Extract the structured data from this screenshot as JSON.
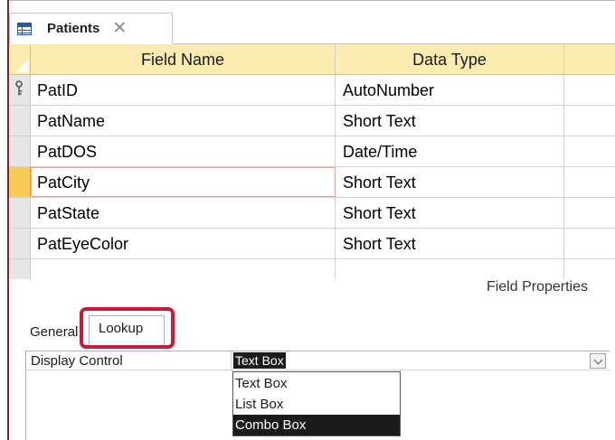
{
  "document_tab": {
    "title": "Patients",
    "close_glyph": "✕",
    "icon": "table-icon"
  },
  "grid": {
    "columns": [
      "Field Name",
      "Data Type"
    ],
    "rows": [
      {
        "field_name": "PatID",
        "data_type": "AutoNumber",
        "primary_key": true
      },
      {
        "field_name": "PatName",
        "data_type": "Short Text"
      },
      {
        "field_name": "PatDOS",
        "data_type": "Date/Time"
      },
      {
        "field_name": "PatCity",
        "data_type": "Short Text",
        "selected": true
      },
      {
        "field_name": "PatState",
        "data_type": "Short Text"
      },
      {
        "field_name": "PatEyeColor",
        "data_type": "Short Text"
      }
    ]
  },
  "field_properties": {
    "label": "Field Properties",
    "tabs": [
      "General",
      "Lookup"
    ],
    "active_tab": "Lookup",
    "property": {
      "name": "Display Control",
      "value": "Text Box"
    },
    "dropdown_options": [
      "Text Box",
      "List Box",
      "Combo Box"
    ],
    "highlighted_option": "Combo Box"
  },
  "colors": {
    "header_fill": "#fdecb2",
    "selected_selector": "#f8cb57",
    "highlight_border": "#c81d3a",
    "accent": "#2b579a"
  }
}
